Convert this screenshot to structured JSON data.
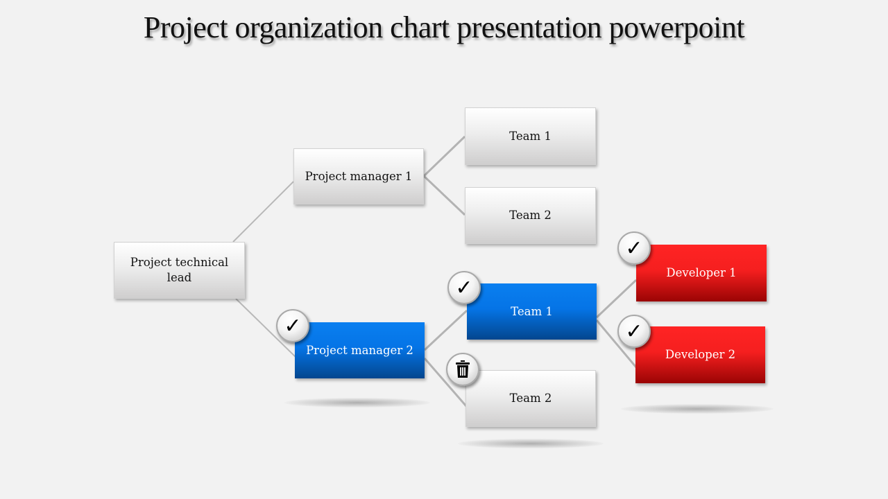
{
  "title": "Project organization chart presentation powerpoint",
  "colors": {
    "background": "#f2f2f2",
    "gray_node": "#e6e6e6",
    "blue_node": "#0574e6",
    "red_node": "#f51f1f",
    "connector": "#b3b3b3"
  },
  "nodes": {
    "lead": {
      "label": "Project technical lead",
      "style": "gray"
    },
    "pm1": {
      "label": "Project manager 1",
      "style": "gray"
    },
    "pm1_team1": {
      "label": "Team 1",
      "style": "gray"
    },
    "pm1_team2": {
      "label": "Team 2",
      "style": "gray"
    },
    "pm2": {
      "label": "Project manager 2",
      "style": "blue",
      "badge": "check-icon"
    },
    "pm2_team1": {
      "label": "Team 1",
      "style": "blue",
      "badge": "check-icon"
    },
    "pm2_team2": {
      "label": "Team 2",
      "style": "gray",
      "badge": "trash-icon"
    },
    "dev1": {
      "label": "Developer 1",
      "style": "red",
      "badge": "check-icon"
    },
    "dev2": {
      "label": "Developer 2",
      "style": "red",
      "badge": "check-icon"
    }
  },
  "icons": {
    "check": "✓",
    "trash": "🗑"
  },
  "edges": [
    [
      "lead",
      "pm1"
    ],
    [
      "lead",
      "pm2"
    ],
    [
      "pm1",
      "pm1_team1"
    ],
    [
      "pm1",
      "pm1_team2"
    ],
    [
      "pm2",
      "pm2_team1"
    ],
    [
      "pm2",
      "pm2_team2"
    ],
    [
      "pm2_team1",
      "dev1"
    ],
    [
      "pm2_team1",
      "dev2"
    ]
  ]
}
